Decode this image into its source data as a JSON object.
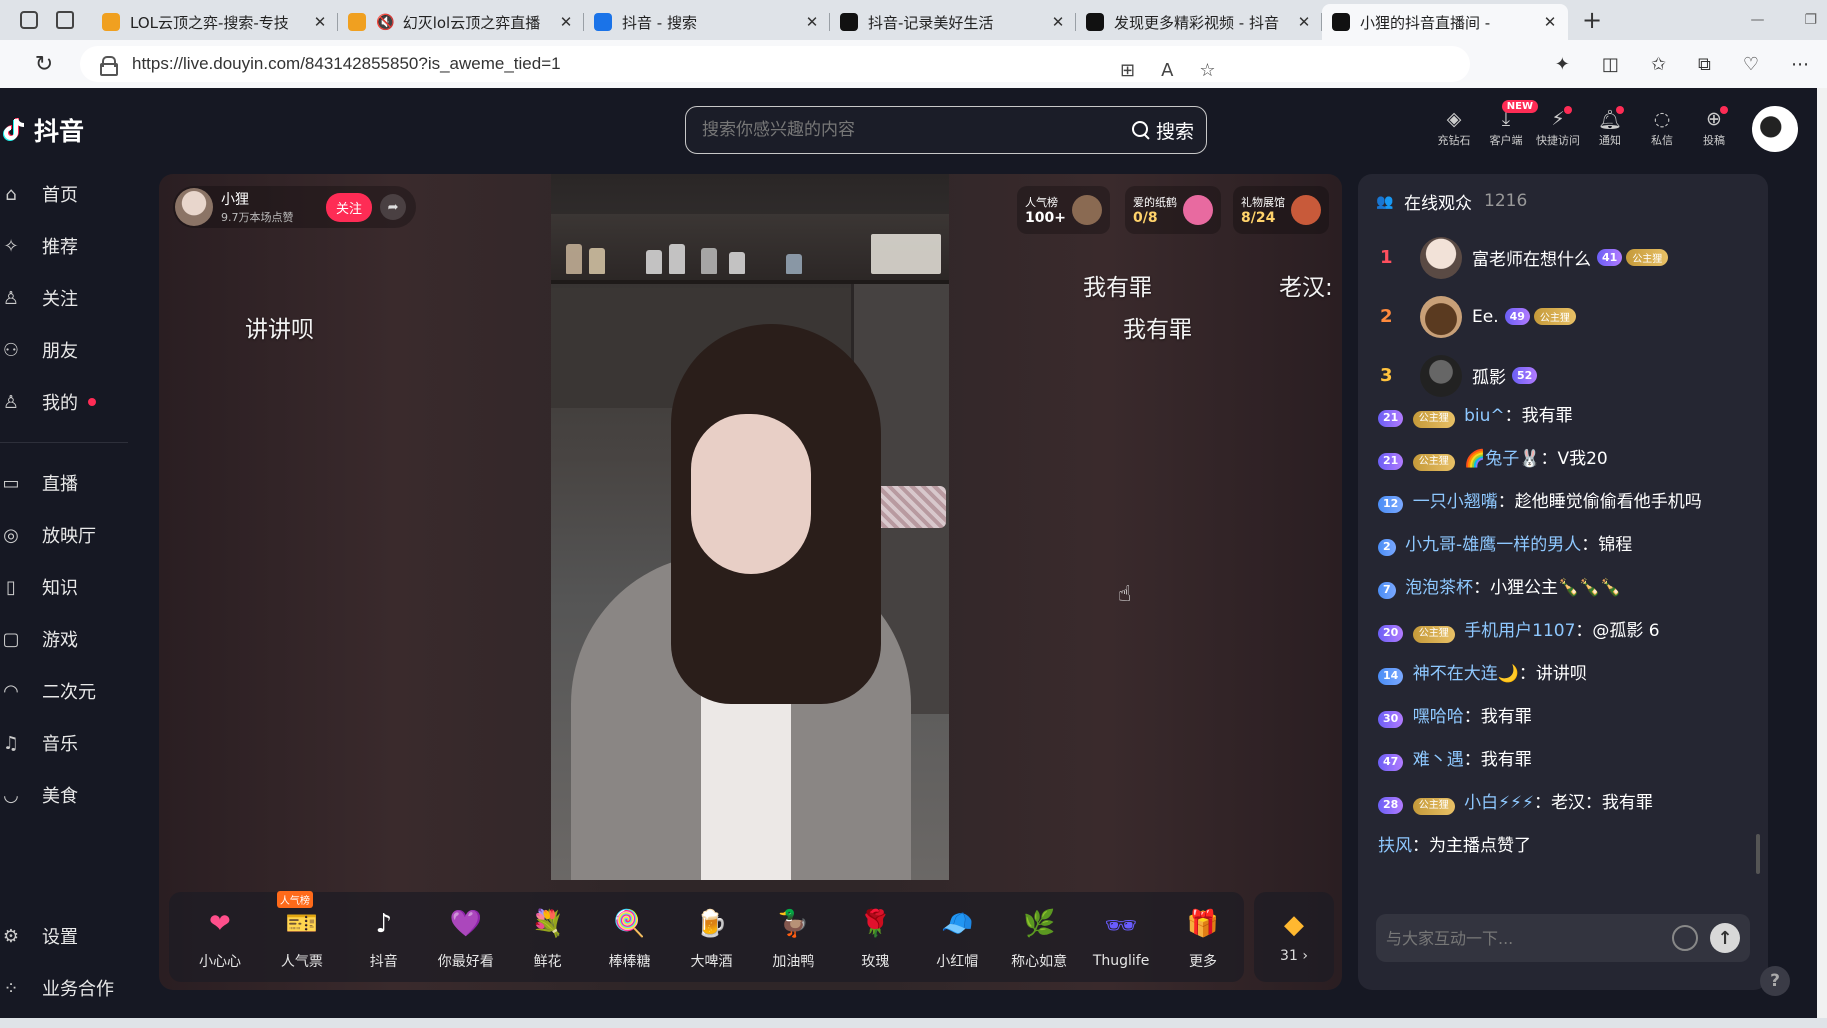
{
  "browser": {
    "tabs": [
      {
        "title": "LOL云顶之弈-搜索-专技",
        "color": "#f0a020"
      },
      {
        "title": "幻灭lol云顶之弈直播",
        "color": "#f0a020",
        "muted": true
      },
      {
        "title": "抖音 - 搜索",
        "color": "#1a73e8"
      },
      {
        "title": "抖音-记录美好生活",
        "color": "#111111"
      },
      {
        "title": "发现更多精彩视频 - 抖音",
        "color": "#111111"
      },
      {
        "title": "小狸的抖音直播间 -",
        "color": "#111111",
        "active": true
      }
    ],
    "url": "https://live.douyin.com/843142855850?is_aweme_tied=1"
  },
  "header": {
    "logo_text": "抖音",
    "search_placeholder": "搜索你感兴趣的内容",
    "search_button": "搜索",
    "tools": [
      {
        "label": "充钻石",
        "icon": "diamond-icon"
      },
      {
        "label": "客户端",
        "icon": "download-icon",
        "badge": "NEW"
      },
      {
        "label": "快捷访问",
        "icon": "lightning-icon",
        "dot": true
      },
      {
        "label": "通知",
        "icon": "bell-icon",
        "dot": true
      },
      {
        "label": "私信",
        "icon": "message-icon"
      },
      {
        "label": "投稿",
        "icon": "upload-icon",
        "dot": true
      }
    ]
  },
  "sidebar": {
    "items": [
      {
        "label": "首页",
        "icon": "home-icon"
      },
      {
        "label": "推荐",
        "icon": "sparkle-icon"
      },
      {
        "label": "关注",
        "icon": "follow-icon"
      },
      {
        "label": "朋友",
        "icon": "friends-icon"
      },
      {
        "label": "我的",
        "icon": "user-icon",
        "dot": true
      }
    ],
    "items2": [
      {
        "label": "直播",
        "icon": "live-icon"
      },
      {
        "label": "放映厅",
        "icon": "cinema-icon"
      },
      {
        "label": "知识",
        "icon": "book-icon"
      },
      {
        "label": "游戏",
        "icon": "gamepad-icon"
      },
      {
        "label": "二次元",
        "icon": "anime-icon"
      },
      {
        "label": "音乐",
        "icon": "music-icon"
      },
      {
        "label": "美食",
        "icon": "food-icon"
      }
    ],
    "bottom": [
      {
        "label": "设置",
        "icon": "settings-icon"
      },
      {
        "label": "业务合作",
        "icon": "grid-icon"
      }
    ]
  },
  "streamer": {
    "name": "小狸",
    "likes": "9.7万本场点赞",
    "follow": "关注"
  },
  "stats": [
    {
      "label": "人气榜",
      "value": "100+"
    },
    {
      "label": "爱的纸鹤",
      "value": "0/8"
    },
    {
      "label": "礼物展馆",
      "value": "8/24"
    }
  ],
  "danmaku": [
    "讲讲呗",
    "我有罪",
    "老汉:",
    "我有罪"
  ],
  "gifts": [
    {
      "name": "小心心",
      "icon": "❤",
      "color": "#ff4f8b"
    },
    {
      "name": "人气票",
      "icon": "🎫",
      "color": "#ff8a66",
      "tag": "人气榜"
    },
    {
      "name": "抖音",
      "icon": "♪",
      "color": "#ffffff"
    },
    {
      "name": "你最好看",
      "icon": "💜",
      "color": "#9b6cff"
    },
    {
      "name": "鲜花",
      "icon": "💐",
      "color": "#ff4444"
    },
    {
      "name": "棒棒糖",
      "icon": "🍭",
      "color": "#ff6fa5"
    },
    {
      "name": "大啤酒",
      "icon": "🍺",
      "color": "#ffd24a"
    },
    {
      "name": "加油鸭",
      "icon": "🦆",
      "color": "#ffcf33"
    },
    {
      "name": "玫瑰",
      "icon": "🌹",
      "color": "#e81e3a"
    },
    {
      "name": "小红帽",
      "icon": "🧢",
      "color": "#e82a2a"
    },
    {
      "name": "称心如意",
      "icon": "🌿",
      "color": "#7fd4c0"
    },
    {
      "name": "Thuglife",
      "icon": "🕶",
      "color": "#6a5cff"
    },
    {
      "name": "更多",
      "icon": "🎁",
      "color": "#ff5aa0"
    }
  ],
  "more_gifts": {
    "count": "31"
  },
  "panel": {
    "title": "在线观众",
    "count": "1216",
    "ranking": [
      {
        "rank": "1",
        "name": "富老师在想什么",
        "level": "41",
        "fan": "公主狸",
        "rank_color": "#ff4f5e"
      },
      {
        "rank": "2",
        "name": "Ee.",
        "level": "49",
        "fan": "公主狸",
        "rank_color": "#ff8a3d"
      },
      {
        "rank": "3",
        "name": "孤影",
        "level": "52",
        "rank_color": "#ffc23d"
      }
    ],
    "messages": [
      {
        "level": "21",
        "fan": "公主狸",
        "user": "biu^",
        "text": "我有罪"
      },
      {
        "level": "21",
        "fan": "公主狸",
        "user": "🌈兔子🐰",
        "text": "V我20"
      },
      {
        "level": "12",
        "user": "一只小翘嘴",
        "text": "趁他睡觉偷偷看他手机吗"
      },
      {
        "level": "2",
        "user": "小九哥-雄鹰一样的男人",
        "text": "锦程"
      },
      {
        "level": "7",
        "user": "泡泡茶杯",
        "text": "小狸公主🍾🍾🍾"
      },
      {
        "level": "20",
        "fan": "公主狸",
        "user": "手机用户1107",
        "text": "@孤影 6"
      },
      {
        "level": "14",
        "user": "神不在大连🌙",
        "text": "讲讲呗"
      },
      {
        "level": "30",
        "user": "嘿哈哈",
        "text": "我有罪"
      },
      {
        "level": "47",
        "user": "难丶遇",
        "text": "我有罪"
      },
      {
        "level": "28",
        "fan": "公主狸",
        "user": "小白⚡⚡⚡",
        "text": "老汉：我有罪"
      }
    ],
    "like_notice": {
      "user": "扶风",
      "text": "为主播点赞了"
    },
    "input_placeholder": "与大家互动一下..."
  }
}
